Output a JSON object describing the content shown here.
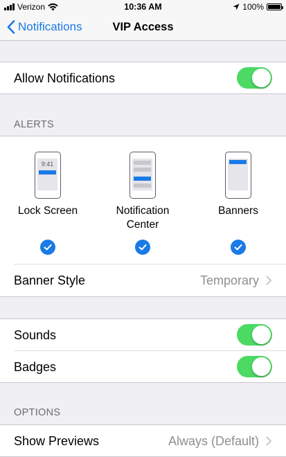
{
  "status_bar": {
    "carrier": "Verizon",
    "time": "10:36 AM",
    "battery": "100%"
  },
  "nav": {
    "back_label": "Notifications",
    "title": "VIP Access"
  },
  "allow_notifications": {
    "label": "Allow Notifications",
    "on": true
  },
  "alerts": {
    "header": "ALERTS",
    "styles": [
      {
        "line1": "Lock Screen",
        "line2": "",
        "checked": true,
        "preview_time": "9:41"
      },
      {
        "line1": "Notification",
        "line2": "Center",
        "checked": true
      },
      {
        "line1": "Banners",
        "line2": "",
        "checked": true
      }
    ],
    "banner_style": {
      "label": "Banner Style",
      "value": "Temporary"
    }
  },
  "sounds": {
    "label": "Sounds",
    "on": true
  },
  "badges": {
    "label": "Badges",
    "on": true
  },
  "options": {
    "header": "OPTIONS",
    "show_previews": {
      "label": "Show Previews",
      "value": "Always (Default)"
    }
  },
  "colors": {
    "accent": "#1a7ae6",
    "toggle_on": "#4cd964",
    "background": "#efeff4"
  }
}
